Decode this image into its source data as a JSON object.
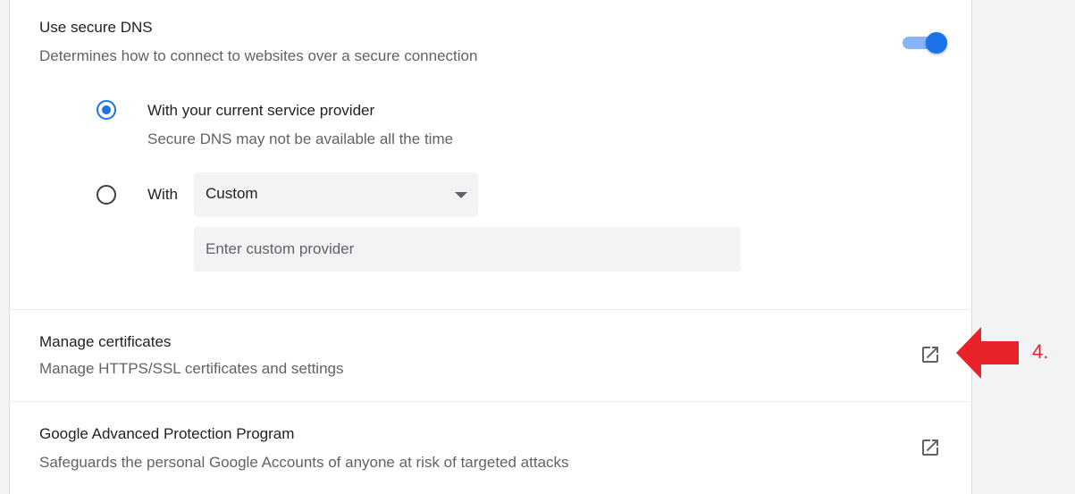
{
  "secure_dns": {
    "title": "Use secure DNS",
    "description": "Determines how to connect to websites over a secure connection",
    "enabled": true,
    "option_current": {
      "label": "With your current service provider",
      "sublabel": "Secure DNS may not be available all the time",
      "selected": true
    },
    "option_custom": {
      "label": "With",
      "selected": false,
      "select_value": "Custom",
      "input_placeholder": "Enter custom provider"
    }
  },
  "manage_certificates": {
    "title": "Manage certificates",
    "description": "Manage HTTPS/SSL certificates and settings",
    "icon": "open-in-new-icon"
  },
  "advanced_protection": {
    "title": "Google Advanced Protection Program",
    "description": "Safeguards the personal Google Accounts of anyone at risk of targeted attacks",
    "icon": "open-in-new-icon"
  },
  "annotation": {
    "label": "4.",
    "color": "#e8232a"
  },
  "colors": {
    "accent": "#1a73e8",
    "toggle_track": "#8ab4f8"
  }
}
